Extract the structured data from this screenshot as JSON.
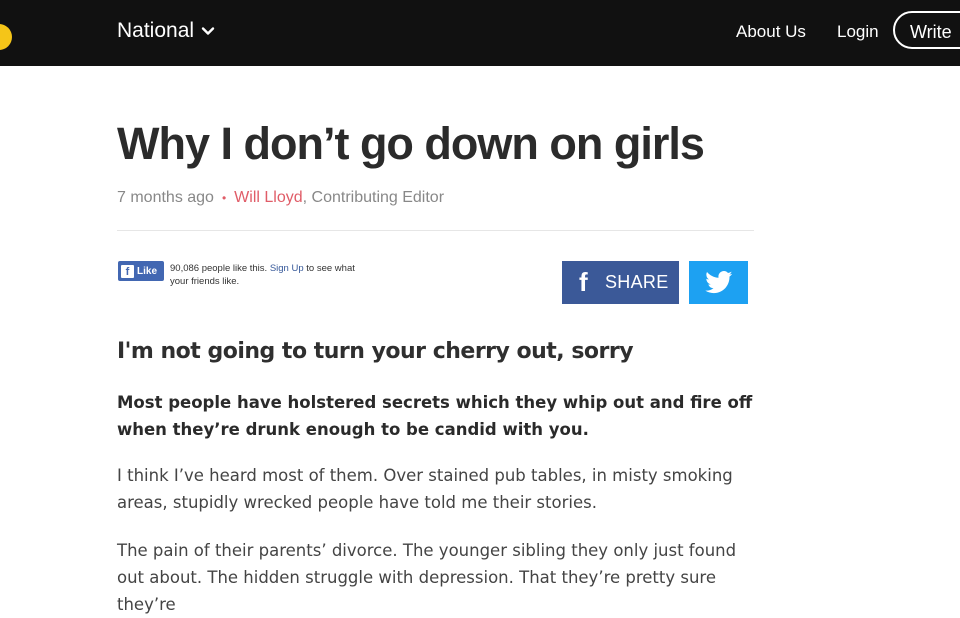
{
  "header": {
    "edition_label": "National",
    "nav": {
      "about": "About Us",
      "login": "Login",
      "write": "Write"
    },
    "brand_color": "#f5c518"
  },
  "article": {
    "title": "Why I don’t go down on girls",
    "time_ago": "7 months ago",
    "author": "Will Lloyd",
    "author_role": ", Contributing Editor",
    "subtitle": "I'm not going to turn your cherry out, sorry",
    "lead": "Most people have holstered secrets which they whip out and fire off when they’re drunk enough to be candid with you.",
    "paragraphs": [
      "I think I’ve heard most of them. Over stained pub tables, in misty smoking areas, stupidly wrecked people have told me their stories.",
      "The pain of their parents’ divorce. The younger sibling they only just found out about. The hidden struggle with depression. That they’re pretty sure they’re"
    ]
  },
  "social": {
    "fb_like_label": "Like",
    "fb_count_text": "90,086 people like this.",
    "fb_signup": "Sign Up",
    "fb_tail": "to see what your friends like.",
    "share_label": "SHARE",
    "facebook_color": "#3b5998",
    "twitter_color": "#1da1f2"
  }
}
